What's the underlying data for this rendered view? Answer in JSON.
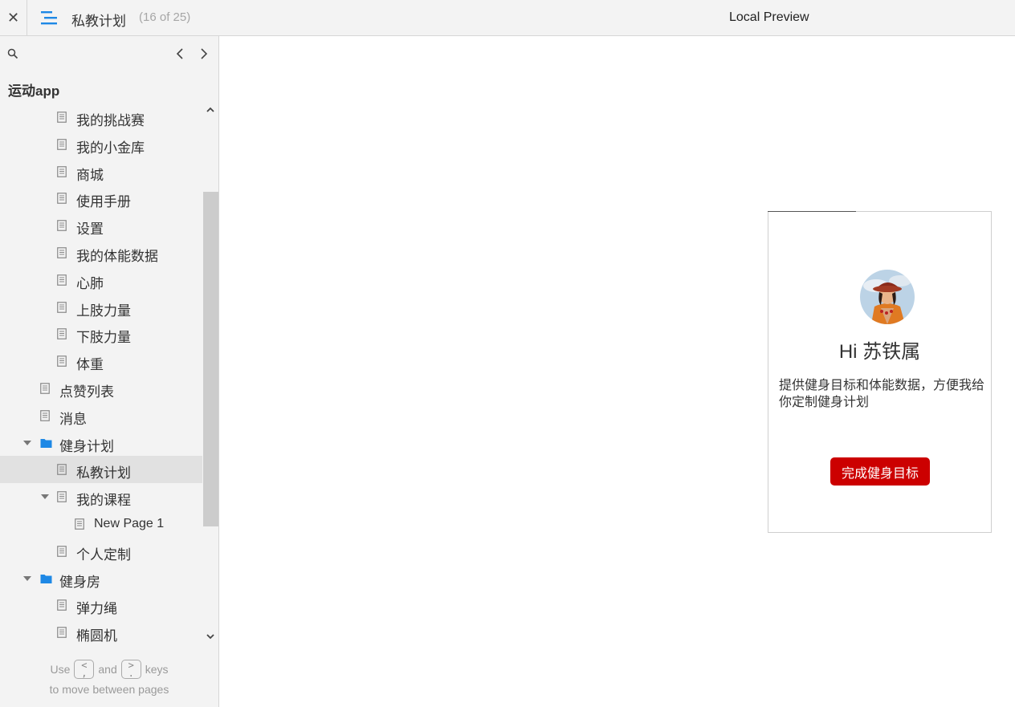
{
  "topbar": {
    "close_glyph": "✕",
    "page_title": "私教计划",
    "page_count": "(16 of 25)",
    "preview_label": "Local Preview"
  },
  "sidebar": {
    "project_name": "运动app",
    "tree": [
      {
        "label": "我的挑战赛",
        "level": 2,
        "type": "page"
      },
      {
        "label": "我的小金库",
        "level": 2,
        "type": "page"
      },
      {
        "label": "商城",
        "level": 2,
        "type": "page"
      },
      {
        "label": "使用手册",
        "level": 2,
        "type": "page"
      },
      {
        "label": "设置",
        "level": 2,
        "type": "page"
      },
      {
        "label": "我的体能数据",
        "level": 2,
        "type": "page"
      },
      {
        "label": "心肺",
        "level": 2,
        "type": "page"
      },
      {
        "label": "上肢力量",
        "level": 2,
        "type": "page"
      },
      {
        "label": "下肢力量",
        "level": 2,
        "type": "page"
      },
      {
        "label": "体重",
        "level": 2,
        "type": "page"
      },
      {
        "label": "点赞列表",
        "level": 1,
        "type": "page"
      },
      {
        "label": "消息",
        "level": 1,
        "type": "page"
      },
      {
        "label": "健身计划",
        "level": 1,
        "type": "folder",
        "expanded": true
      },
      {
        "label": "私教计划",
        "level": 2,
        "type": "page",
        "selected": true
      },
      {
        "label": "我的课程",
        "level": 2,
        "type": "page",
        "expanded": true
      },
      {
        "label": "New Page 1",
        "level": 3,
        "type": "page"
      },
      {
        "label": "个人定制",
        "level": 2,
        "type": "page"
      },
      {
        "label": "健身房",
        "level": 1,
        "type": "folder",
        "expanded": true
      },
      {
        "label": "弹力绳",
        "level": 2,
        "type": "page"
      },
      {
        "label": "椭圆机",
        "level": 2,
        "type": "page"
      }
    ],
    "hint": {
      "use": "Use",
      "key_prev": "<",
      "key_prev_sub": ",",
      "and": "and",
      "key_next": ">",
      "key_next_sub": ".",
      "keys": "keys",
      "line2": "to move between pages"
    }
  },
  "preview": {
    "greeting": "Hi 苏铁属",
    "description": "提供健身目标和体能数据，方便我给你定制健身计划",
    "cta_label": "完成健身目标"
  },
  "colors": {
    "accent_menu": "#1e88e5",
    "folder": "#1e88e5",
    "cta": "#cc0000"
  }
}
